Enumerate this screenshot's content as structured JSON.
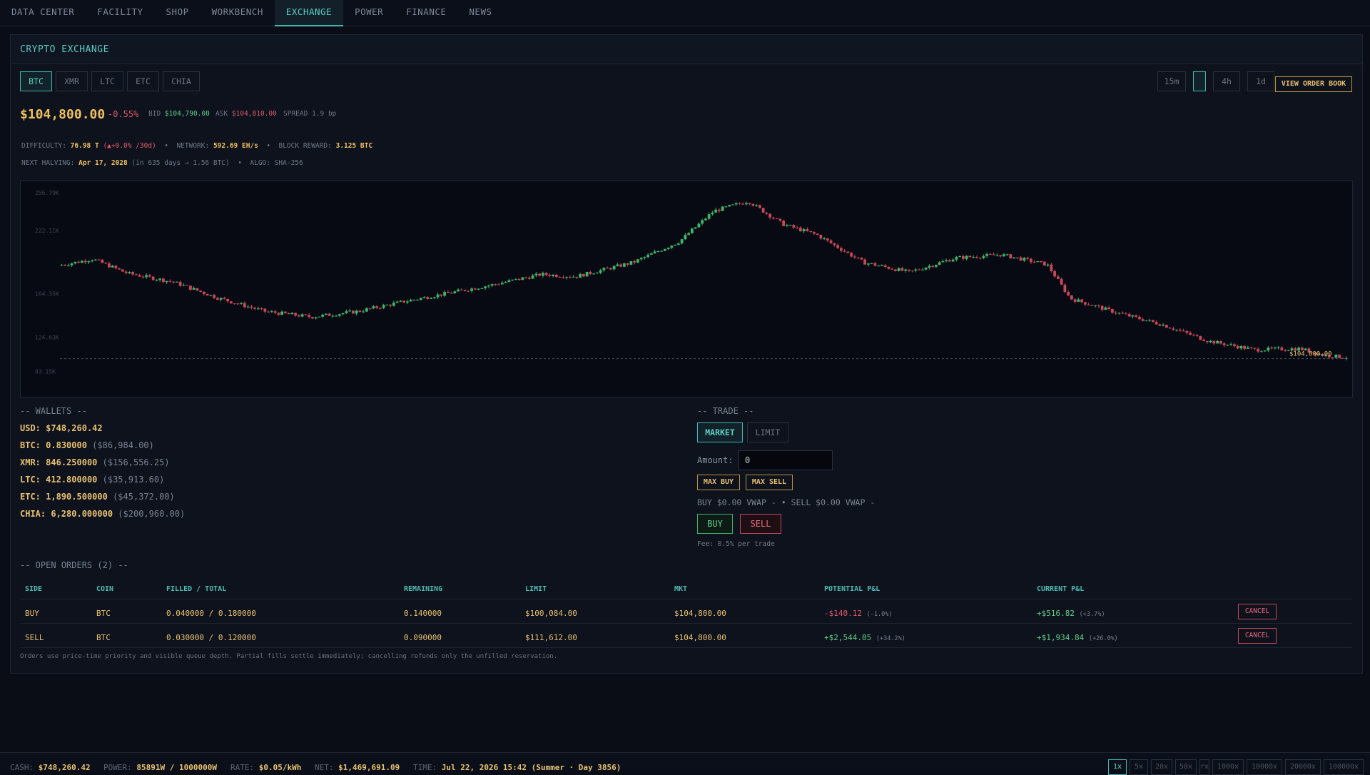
{
  "nav": {
    "tabs": [
      "DATA CENTER",
      "FACILITY",
      "SHOP",
      "WORKBENCH",
      "EXCHANGE",
      "POWER",
      "FINANCE",
      "NEWS"
    ],
    "active": "EXCHANGE"
  },
  "panel": {
    "title": "CRYPTO EXCHANGE"
  },
  "coins": [
    "BTC",
    "XMR",
    "LTC",
    "ETC",
    "CHIA"
  ],
  "active_coin": "BTC",
  "timeframes": [
    "15m",
    "",
    "4h",
    "1d"
  ],
  "active_timeframe_index": 1,
  "view_order_book": "VIEW ORDER BOOK",
  "ticker": {
    "price": "$104,800.00",
    "change": "-0.55%",
    "bid_label": "BID",
    "bid": "$104,790.00",
    "ask_label": "ASK",
    "ask": "$104,810.00",
    "spread_label": "SPREAD",
    "spread": "1.9 bp"
  },
  "info": {
    "difficulty_label": "DIFFICULTY:",
    "difficulty": "76.98 T",
    "difficulty_change": "(▲+0.0% /30d)",
    "network_label": "NETWORK:",
    "network": "592.69 EH/s",
    "reward_label": "BLOCK REWARD:",
    "reward": "3.125 BTC",
    "halving_label": "NEXT HALVING:",
    "halving": "Apr 17, 2028",
    "halving_detail": "(in 635 days → 1.56 BTC)",
    "algo": "ALGO: SHA-256",
    "sep": "•"
  },
  "chart_data": {
    "type": "candlestick",
    "y_ticks": [
      "256.79K",
      "222.11K",
      "164.35K",
      "124.63K",
      "93.15K"
    ],
    "y_tick_values": [
      256790,
      222110,
      164350,
      124630,
      93150
    ],
    "ylim": [
      83000,
      262000
    ],
    "last_price_label": "$104,800.00",
    "last_price": 104800,
    "anchors": [
      [
        0,
        190000
      ],
      [
        0.03,
        196000
      ],
      [
        0.06,
        183000
      ],
      [
        0.1,
        175000
      ],
      [
        0.14,
        160000
      ],
      [
        0.18,
        148000
      ],
      [
        0.22,
        143000
      ],
      [
        0.26,
        148000
      ],
      [
        0.3,
        157000
      ],
      [
        0.34,
        165000
      ],
      [
        0.38,
        173000
      ],
      [
        0.42,
        182000
      ],
      [
        0.45,
        180000
      ],
      [
        0.5,
        193000
      ],
      [
        0.54,
        212000
      ],
      [
        0.57,
        240000
      ],
      [
        0.6,
        249000
      ],
      [
        0.63,
        228000
      ],
      [
        0.66,
        218000
      ],
      [
        0.7,
        193000
      ],
      [
        0.74,
        184000
      ],
      [
        0.78,
        197000
      ],
      [
        0.82,
        200000
      ],
      [
        0.86,
        191000
      ],
      [
        0.88,
        160000
      ],
      [
        0.92,
        147000
      ],
      [
        0.96,
        136000
      ],
      [
        1.0,
        121000
      ],
      [
        1.04,
        113000
      ],
      [
        1.08,
        114000
      ],
      [
        1.1,
        108000
      ],
      [
        1.12,
        106000
      ]
    ]
  },
  "wallets": {
    "heading": "-- WALLETS --",
    "rows": [
      {
        "label": "USD:",
        "amount": "$748,260.42",
        "usd": ""
      },
      {
        "label": "BTC:",
        "amount": "0.830000",
        "usd": "($86,984.00)"
      },
      {
        "label": "XMR:",
        "amount": "846.250000",
        "usd": "($156,556.25)"
      },
      {
        "label": "LTC:",
        "amount": "412.800000",
        "usd": "($35,913.60)"
      },
      {
        "label": "ETC:",
        "amount": "1,890.500000",
        "usd": "($45,372.00)"
      },
      {
        "label": "CHIA:",
        "amount": "6,280.000000",
        "usd": "($200,960.00)"
      }
    ]
  },
  "trade": {
    "heading": "-- TRADE --",
    "modes": [
      "MARKET",
      "LIMIT"
    ],
    "active_mode": "MARKET",
    "amount_label": "Amount:",
    "amount_value": "0",
    "max_buy": "MAX BUY",
    "max_sell": "MAX SELL",
    "vwap": "BUY $0.00 VWAP -   •   SELL $0.00 VWAP -",
    "buy": "BUY",
    "sell": "SELL",
    "fee": "Fee: 0.5% per trade"
  },
  "orders": {
    "heading": "-- OPEN ORDERS (2) --",
    "columns": [
      "SIDE",
      "COIN",
      "FILLED / TOTAL",
      "REMAINING",
      "LIMIT",
      "MKT",
      "POTENTIAL P&L",
      "CURRENT P&L"
    ],
    "rows": [
      {
        "side": "BUY",
        "coin": "BTC",
        "filled": "0.040000 / 0.180000",
        "remaining": "0.140000",
        "limit": "$100,084.00",
        "mkt": "$104,800.00",
        "potential": "-$140.12",
        "potential_pct": "(-1.0%)",
        "potential_color": "#e05a6a",
        "current": "+$516.82",
        "current_pct": "(+3.7%)",
        "current_color": "#5fd08a",
        "cancel": "CANCEL"
      },
      {
        "side": "SELL",
        "coin": "BTC",
        "filled": "0.030000 / 0.120000",
        "remaining": "0.090000",
        "limit": "$111,612.00",
        "mkt": "$104,800.00",
        "potential": "+$2,544.05",
        "potential_pct": "(+34.2%)",
        "potential_color": "#5fd08a",
        "current": "+$1,934.84",
        "current_pct": "(+26.0%)",
        "current_color": "#5fd08a",
        "cancel": "CANCEL"
      }
    ],
    "note": "Orders use price-time priority and visible queue depth. Partial fills settle immediately; cancelling refunds only the unfilled reservation."
  },
  "status": {
    "cash_label": "CASH:",
    "cash": "$748,260.42",
    "power_label": "POWER:",
    "power": "85891W / 1000000W",
    "rate_label": "RATE:",
    "rate": "$0.05/kWh",
    "net_label": "NET:",
    "net": "$1,469,691.09",
    "time_label": "TIME:",
    "time": "Jul 22, 2026 15:42 (Summer · Day 3856)",
    "speeds": [
      "1x",
      "5x",
      "20x",
      "50x",
      "rx",
      "1000x",
      "10000x",
      "20000x",
      "100000x"
    ],
    "active_speed": "1x"
  }
}
